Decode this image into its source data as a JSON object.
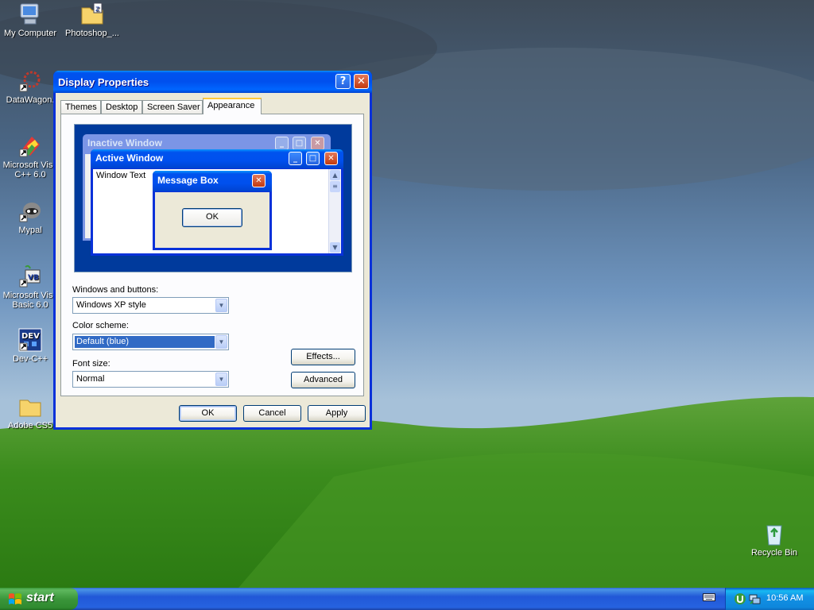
{
  "desktop": {
    "icons": [
      {
        "label": "My Computer",
        "icon": "my-computer-icon"
      },
      {
        "label": "Photoshop_...",
        "icon": "zip-folder-icon"
      },
      {
        "label": "DataWagon.",
        "icon": "shortcut-icon"
      },
      {
        "label": "Microsoft Visu",
        "label2": "C++ 6.0",
        "icon": "visual-cpp-icon"
      },
      {
        "label": "Mypal",
        "icon": "raccoon-icon"
      },
      {
        "label": "Microsoft Visu",
        "label2": "Basic 6.0",
        "icon": "visual-basic-icon"
      },
      {
        "label": "Dev-C++",
        "icon": "dev-cpp-icon"
      },
      {
        "label": "Adobe CS5",
        "icon": "folder-icon"
      },
      {
        "label": "Recycle Bin",
        "icon": "recycle-bin-icon"
      }
    ]
  },
  "dialog": {
    "title": "Display Properties",
    "help_glyph": "?",
    "close_glyph": "✕",
    "tabs": [
      {
        "label": "Themes",
        "active": false
      },
      {
        "label": "Desktop",
        "active": false
      },
      {
        "label": "Screen Saver",
        "active": false
      },
      {
        "label": "Appearance",
        "active": true
      }
    ],
    "preview": {
      "inactive_title": "Inactive Window",
      "active_title": "Active Window",
      "window_text": "Window Text",
      "message_box_title": "Message Box",
      "ok_label": "OK"
    },
    "fields": {
      "windows_buttons_label": "Windows and buttons:",
      "windows_buttons_value": "Windows XP style",
      "color_scheme_label": "Color scheme:",
      "color_scheme_value": "Default (blue)",
      "font_size_label": "Font size:",
      "font_size_value": "Normal"
    },
    "buttons": {
      "effects": "Effects...",
      "advanced": "Advanced",
      "ok": "OK",
      "cancel": "Cancel",
      "apply": "Apply"
    }
  },
  "taskbar": {
    "start_label": "start",
    "clock": "10:56 AM"
  },
  "colors": {
    "xp_blue": "#0054e3",
    "start_green": "#3b963b",
    "tray_blue": "#1291e5",
    "dialog_face": "#ece9d8"
  }
}
